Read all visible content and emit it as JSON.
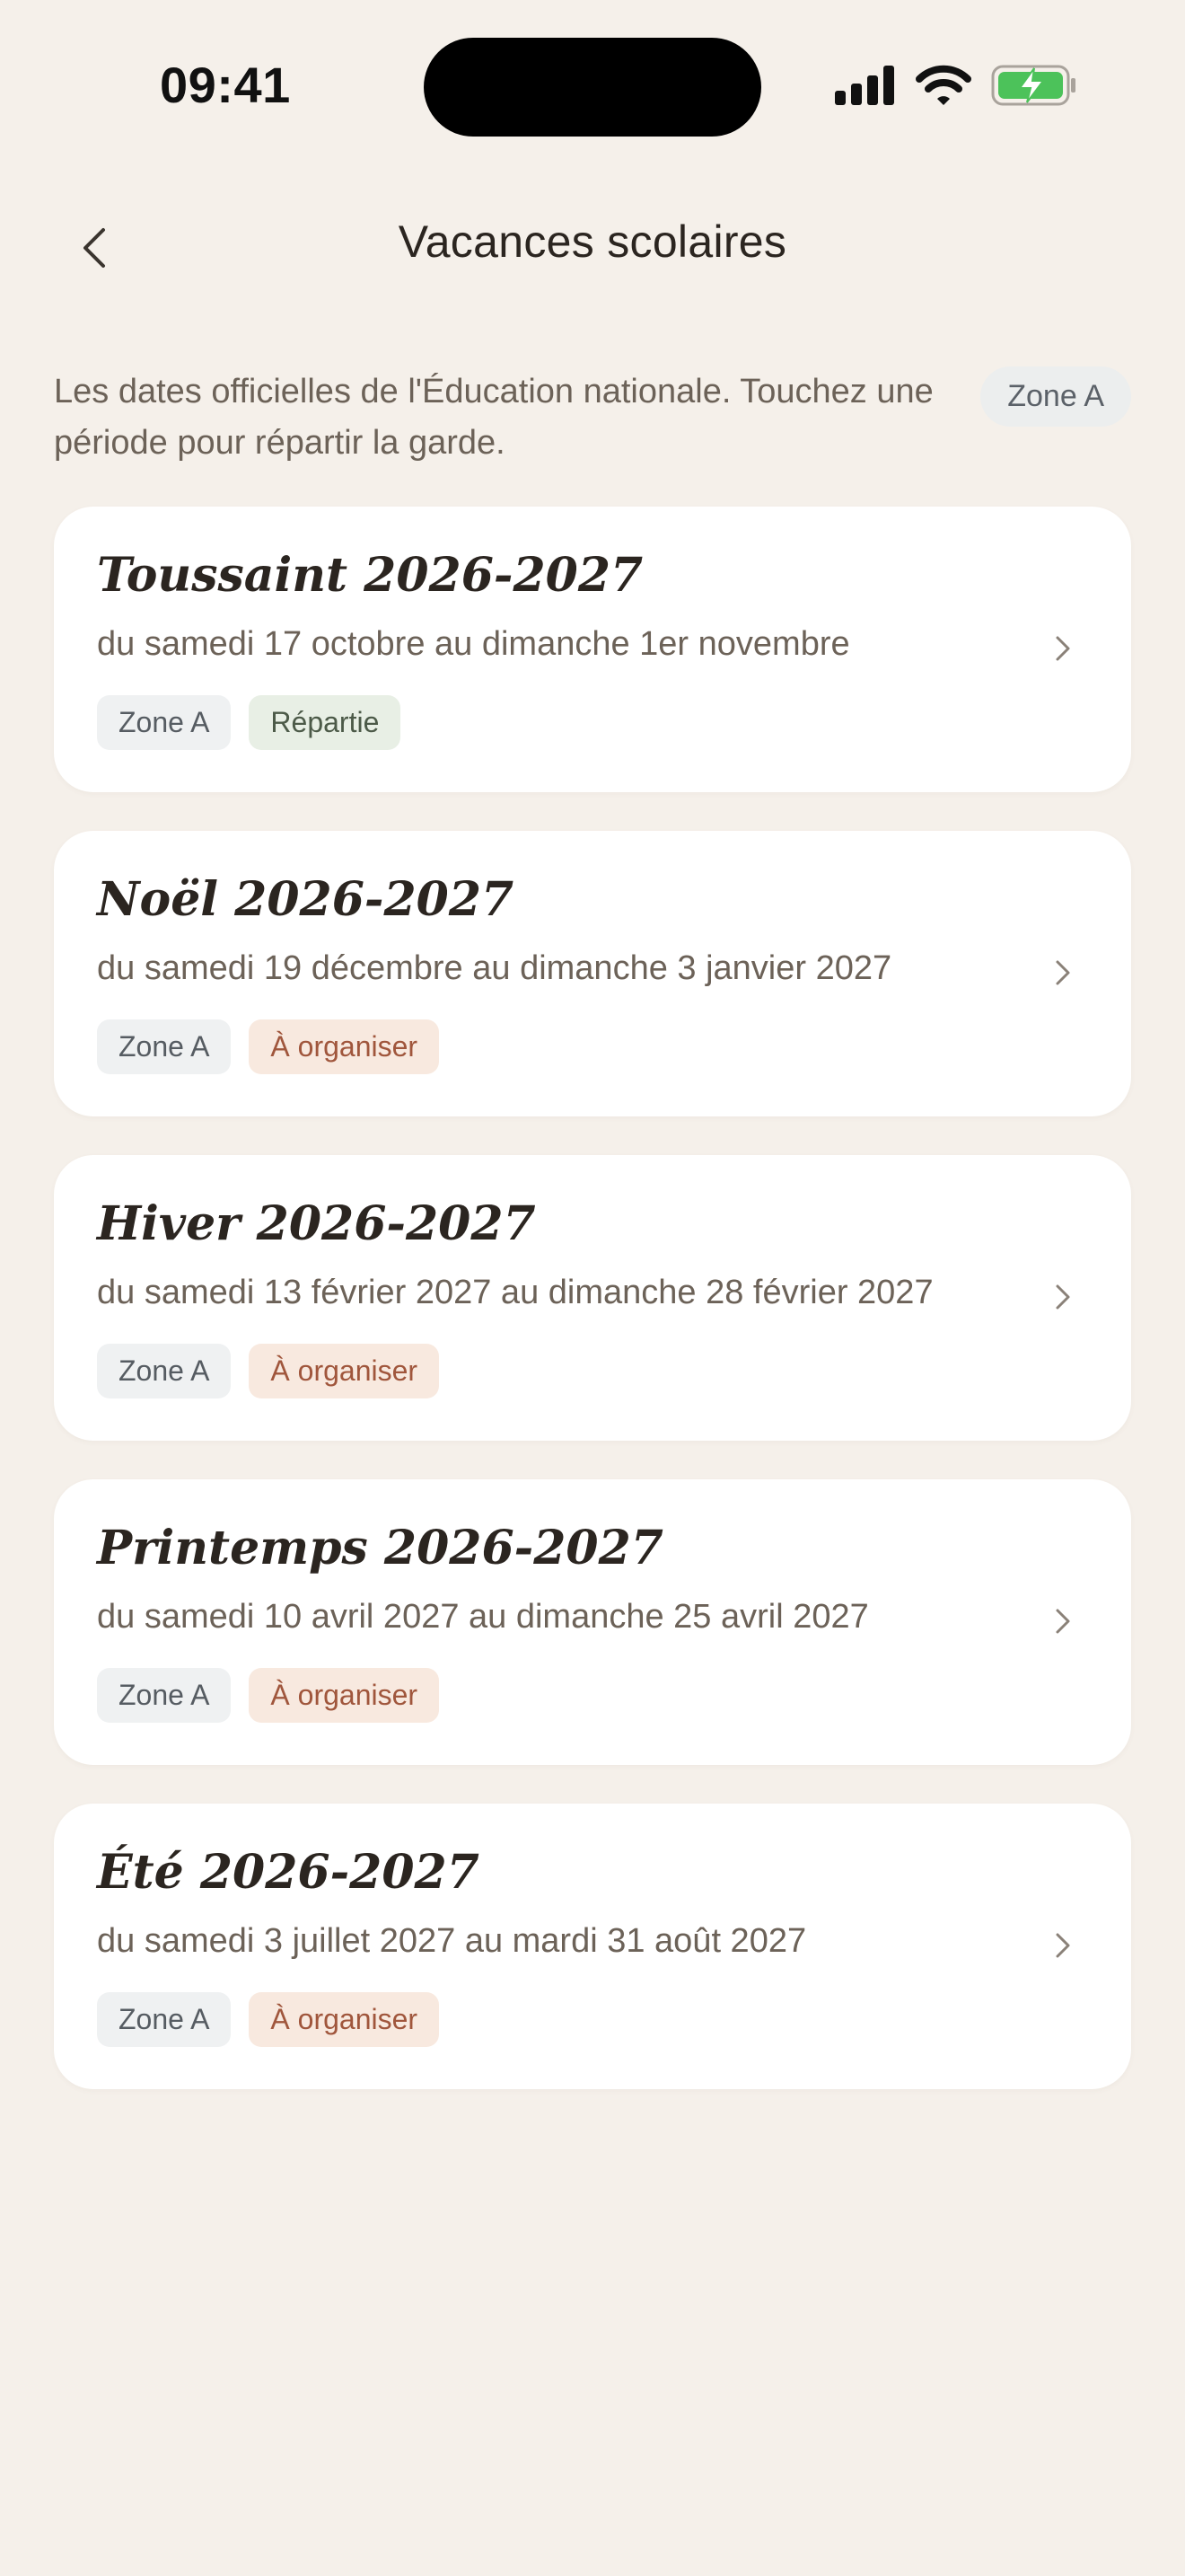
{
  "status_bar": {
    "time": "09:41"
  },
  "nav": {
    "title": "Vacances scolaires",
    "back_icon": "chevron-left-icon"
  },
  "intro": {
    "text": "Les dates officielles de l'Éducation nationale. Touchez une période pour répartir la garde.",
    "zone_chip": "Zone A"
  },
  "periods": [
    {
      "title": "Toussaint 2026-2027",
      "dates": "du samedi 17 octobre au dimanche 1er novembre",
      "zone_tag": "Zone A",
      "status": "Répartie",
      "status_kind": "done"
    },
    {
      "title": "Noël 2026-2027",
      "dates": "du samedi 19 décembre au dimanche 3 janvier 2027",
      "zone_tag": "Zone A",
      "status": "À organiser",
      "status_kind": "todo"
    },
    {
      "title": "Hiver 2026-2027",
      "dates": "du samedi 13 février 2027 au dimanche 28 février 2027",
      "zone_tag": "Zone A",
      "status": "À organiser",
      "status_kind": "todo"
    },
    {
      "title": "Printemps 2026-2027",
      "dates": "du samedi 10 avril 2027 au dimanche 25 avril 2027",
      "zone_tag": "Zone A",
      "status": "À organiser",
      "status_kind": "todo"
    },
    {
      "title": "Été 2026-2027",
      "dates": "du samedi 3 juillet 2027 au mardi 31 août 2027",
      "zone_tag": "Zone A",
      "status": "À organiser",
      "status_kind": "todo"
    }
  ],
  "colors": {
    "background": "#f5f0ea",
    "card": "#ffffff",
    "status_done_bg": "#e8efe5",
    "status_todo_bg": "#f8e9df",
    "status_todo_text": "#a0563c",
    "battery_charge": "#4cc25a"
  }
}
